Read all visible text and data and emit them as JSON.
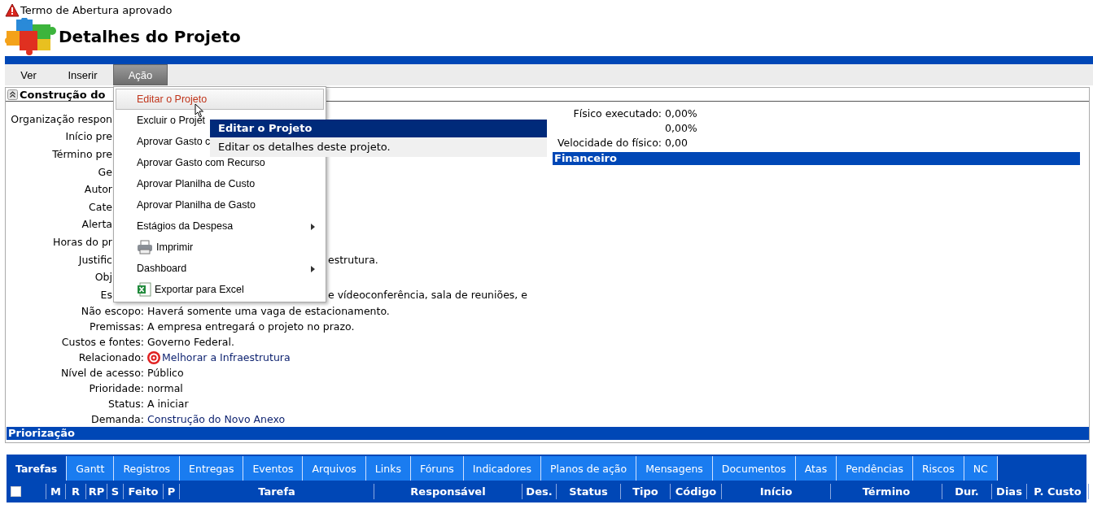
{
  "alert": {
    "text": "Termo de Abertura aprovado"
  },
  "page_title": "Detalhes do Projeto",
  "menubar": [
    {
      "label": "Ver",
      "selected": false
    },
    {
      "label": "Inserir",
      "selected": false
    },
    {
      "label": "Ação",
      "selected": true
    }
  ],
  "panel": {
    "title": "Construção do",
    "rows": [
      {
        "label": "Organização respon",
        "kind": "partial"
      },
      {
        "label": "Início pre",
        "kind": "partial"
      },
      {
        "label": "Término pre",
        "kind": "partial"
      },
      {
        "label": "Ge",
        "kind": "partial"
      },
      {
        "label": "Autor",
        "kind": "partial"
      },
      {
        "label": "Cate",
        "kind": "partial"
      },
      {
        "label": "Alerta",
        "kind": "partial"
      },
      {
        "label": "Horas do pr",
        "kind": "partial"
      },
      {
        "label": "Justific",
        "kind": "partial",
        "value": "estrutura."
      },
      {
        "label": "Obj",
        "kind": "partial"
      },
      {
        "label": "Es",
        "kind": "partial",
        "value": "e vídeoconferência, sala de reuniões, e"
      },
      {
        "label": "Não escopo:",
        "kind": "text",
        "value": "Haverá somente uma vaga de estacionamento."
      },
      {
        "label": "Premissas:",
        "kind": "text",
        "value": "A empresa entregará o projeto no prazo."
      },
      {
        "label": "Custos e fontes:",
        "kind": "text",
        "value": "Governo Federal."
      },
      {
        "label": "Relacionado:",
        "kind": "target-link",
        "value": "Melhorar a Infraestrutura"
      },
      {
        "label": "Nível de acesso:",
        "kind": "text",
        "value": "Público"
      },
      {
        "label": "Prioridade:",
        "kind": "text",
        "value": "normal"
      },
      {
        "label": "Status:",
        "kind": "text",
        "value": "A iniciar"
      },
      {
        "label": "Demanda:",
        "kind": "link",
        "value": "Construção do Novo Anexo"
      }
    ],
    "stats": [
      {
        "label": "Físico executado:",
        "value": "0,00%"
      },
      {
        "value": "0,00%"
      },
      {
        "label": "Velocidade do físico:",
        "value": "0,00"
      }
    ],
    "financeiro_bar": "Financeiro",
    "priorizacao_bar": "Priorização"
  },
  "action_menu": {
    "items": [
      {
        "label": "Editar o Projeto",
        "selected": true,
        "kind": "plain"
      },
      {
        "label": "Excluir o Projet",
        "selected": false,
        "kind": "plain"
      },
      {
        "label": "Aprovar Gasto c",
        "selected": false,
        "kind": "plain"
      },
      {
        "label": "Aprovar Gasto com Recurso",
        "selected": false,
        "kind": "plain"
      },
      {
        "label": "Aprovar Planilha de Custo",
        "selected": false,
        "kind": "plain"
      },
      {
        "label": "Aprovar Planilha de Gasto",
        "selected": false,
        "kind": "plain"
      },
      {
        "label": "Estágios da Despesa",
        "selected": false,
        "kind": "submenu"
      },
      {
        "label": "Imprimir",
        "selected": false,
        "kind": "printer"
      },
      {
        "label": "Dashboard",
        "selected": false,
        "kind": "submenu"
      },
      {
        "label": "Exportar para Excel",
        "selected": false,
        "kind": "spreadsheet"
      }
    ]
  },
  "tooltip": {
    "title": "Editar o Projeto",
    "text": "Editar os detalhes deste projeto."
  },
  "tabs": [
    {
      "label": "Tarefas",
      "selected": true
    },
    {
      "label": "Gantt",
      "selected": false
    },
    {
      "label": "Registros",
      "selected": false
    },
    {
      "label": "Entregas",
      "selected": false
    },
    {
      "label": "Eventos",
      "selected": false
    },
    {
      "label": "Arquivos",
      "selected": false
    },
    {
      "label": "Links",
      "selected": false
    },
    {
      "label": "Fóruns",
      "selected": false
    },
    {
      "label": "Indicadores",
      "selected": false
    },
    {
      "label": "Planos de ação",
      "selected": false
    },
    {
      "label": "Mensagens",
      "selected": false
    },
    {
      "label": "Documentos",
      "selected": false
    },
    {
      "label": "Atas",
      "selected": false
    },
    {
      "label": "Pendências",
      "selected": false
    },
    {
      "label": "Riscos",
      "selected": false
    },
    {
      "label": "NC",
      "selected": false
    }
  ],
  "table": {
    "select_all": {
      "checked": false
    },
    "columns": [
      "M",
      "R",
      "RP",
      "S",
      "Feito",
      "P",
      "Tarefa",
      "Responsável",
      "Des.",
      "Status",
      "Tipo",
      "Código",
      "Início",
      "Término",
      "Dur.",
      "Dias",
      "P. Custo"
    ]
  }
}
